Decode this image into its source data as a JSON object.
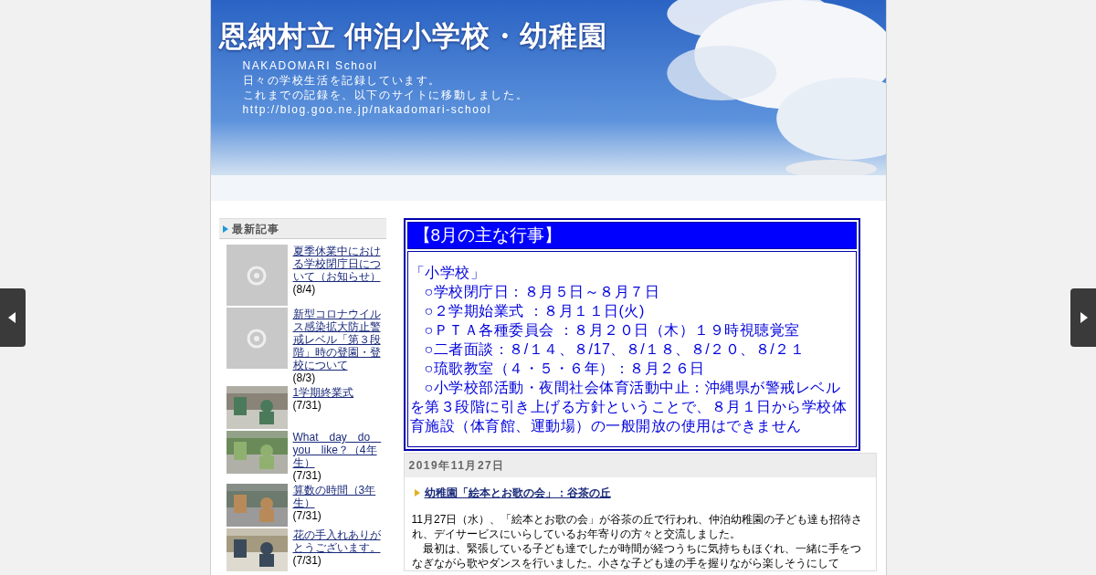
{
  "header": {
    "title": "恩納村立 仲泊小学校・幼稚園",
    "subtitle_lines": [
      "NAKADOMARI School",
      "日々の学校生活を記録しています。",
      "これまでの記録を、以下のサイトに移動しました。",
      "http://blog.goo.ne.jp/nakadomari-school"
    ]
  },
  "sidebar": {
    "heading": "最新記事",
    "items": [
      {
        "title": "夏季休業中における学校閉庁日について（お知らせ）",
        "date": "(8/4)",
        "kind": "no_image"
      },
      {
        "title": "新型コロナウイルス感染拡大防止警戒レベル「第３段階」時の登園・登校について",
        "date": "(8/3)",
        "kind": "no_image"
      },
      {
        "title": "1学期終業式",
        "date": "(7/31)",
        "kind": "picture"
      },
      {
        "title": "What　day　do　you　like？（4年生）",
        "date": "(7/31)",
        "kind": "picture"
      },
      {
        "title": "算数の時間（3年生）",
        "date": "(7/31)",
        "kind": "picture"
      },
      {
        "title": "花の手入れありがとうございます。",
        "date": "(7/31)",
        "kind": "picture"
      }
    ]
  },
  "notice": {
    "title": "【8月の主な行事】",
    "lines": [
      {
        "kind": "heading",
        "text": "「小学校」"
      },
      {
        "kind": "item",
        "text": "○学校閉庁日：８月５日～８月７日"
      },
      {
        "kind": "item",
        "text": "○２学期始業式 ：８月１１日(火)"
      },
      {
        "kind": "item",
        "text": "○ＰＴＡ各種委員会 ：８月２０日（木）１９時視聴覚室"
      },
      {
        "kind": "item",
        "text": "○二者面談：８/１４、８/17、８/１８、８/２０、８/２１"
      },
      {
        "kind": "item",
        "text": "○琉歌教室（４・５・６年）：８月２６日"
      },
      {
        "kind": "item",
        "text": "○小学校部活動・夜間社会体育活動中止：沖縄県が警戒レベルを第３段階に引き上げる方針ということで、８月１日から学校体育施設（体育館、運動場）の一般開放の使用はできません"
      }
    ]
  },
  "post": {
    "date": "2019年11月27日",
    "title": "幼稚園「絵本とお歌の会」：谷茶の丘",
    "paragraphs": [
      "11月27日（水）、「絵本とお歌の会」が谷茶の丘で行われ、仲泊幼稚園の子ども達も招待され、デイサービスにいらしているお年寄りの方々と交流しました。",
      "最初は、緊張している子ども達でしたが時間が経つうちに気持ちもほぐれ、一緒に手をつなぎながら歌やダンスを行いました。小さな子ども達の手を握りながら楽しそうにして"
    ]
  }
}
